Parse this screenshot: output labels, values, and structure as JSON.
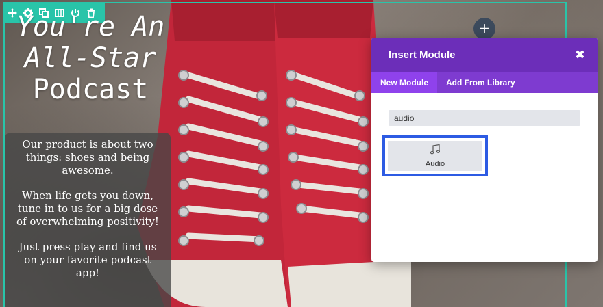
{
  "builder": {
    "toolbar": {
      "icons": [
        "move-icon",
        "settings-icon",
        "duplicate-icon",
        "columns-icon",
        "save-icon",
        "delete-icon"
      ]
    },
    "add_button_label": "+"
  },
  "content": {
    "headline": {
      "line1": "You're An",
      "line2": "All-Star",
      "line3": "Podcast"
    },
    "paragraphs": [
      "Our product is about two things: shoes and being awesome.",
      "When life gets you down, tune in to us for a big dose of overwhelming positivity!",
      "Just press play and find us on your favorite podcast app!"
    ]
  },
  "modal": {
    "title": "Insert Module",
    "close_label": "✖",
    "tabs": [
      {
        "label": "New Module",
        "active": true
      },
      {
        "label": "Add From Library",
        "active": false
      }
    ],
    "search": {
      "value": "audio"
    },
    "results": [
      {
        "label": "Audio",
        "icon": "music-note-icon"
      }
    ]
  },
  "colors": {
    "section_outline": "#29c4a9",
    "modal_header": "#6c2eb9",
    "modal_tabs": "#7e3bd0",
    "highlight": "#2d5be3"
  }
}
